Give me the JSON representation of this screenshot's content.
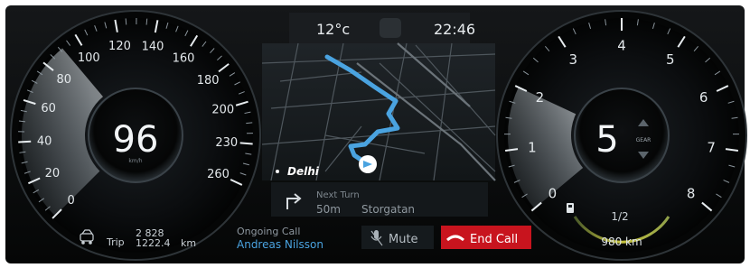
{
  "header": {
    "temperature": "12°c",
    "time": "22:46"
  },
  "speedometer": {
    "speed": "96",
    "unit": "km/h",
    "scale": [
      "0",
      "20",
      "40",
      "60",
      "80",
      "100",
      "120",
      "140",
      "160",
      "180",
      "200",
      "230",
      "260"
    ],
    "speed_fraction": 0.38
  },
  "trip": {
    "label": "Trip",
    "odometer": "2 828",
    "trip_distance": "1222.4",
    "unit": "km"
  },
  "navigation": {
    "city_label": "Delhi",
    "next_turn_label": "Next Turn",
    "distance": "50m",
    "street": "Storgatan"
  },
  "call": {
    "status_label": "Ongoing Call",
    "caller": "Andreas Nilsson",
    "mute_label": "Mute",
    "end_call_label": "End Call",
    "end_call_color": "#c8141e"
  },
  "tachometer": {
    "gear": "5",
    "gear_label": "GEAR",
    "scale": [
      "0",
      "1",
      "2",
      "3",
      "4",
      "5",
      "6",
      "7",
      "8"
    ],
    "rpm_fraction": 0.25,
    "range": "980 km",
    "fuel_half_label": "1/2"
  },
  "colors": {
    "accent_blue": "#4aa3e0",
    "dial_glow": "#cfd8de"
  }
}
